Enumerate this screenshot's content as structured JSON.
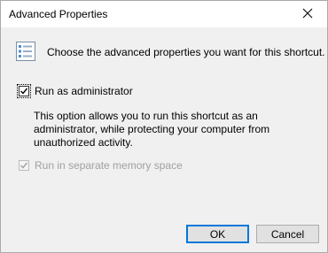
{
  "window": {
    "title": "Advanced Properties",
    "close_icon": "close-icon"
  },
  "header": {
    "icon": "properties-list-icon",
    "text": "Choose the advanced properties you want for this shortcut."
  },
  "options": {
    "run_as_admin": {
      "label": "Run as administrator",
      "checked": true,
      "description": "This option allows you to run this shortcut as an administrator, while protecting your computer from unauthorized activity."
    },
    "separate_memory": {
      "label": "Run in separate memory space",
      "checked": true,
      "disabled": true
    }
  },
  "buttons": {
    "ok_label": "OK",
    "cancel_label": "Cancel"
  },
  "colors": {
    "accent": "#0078d7",
    "disabled_text": "#a0a0a0"
  }
}
